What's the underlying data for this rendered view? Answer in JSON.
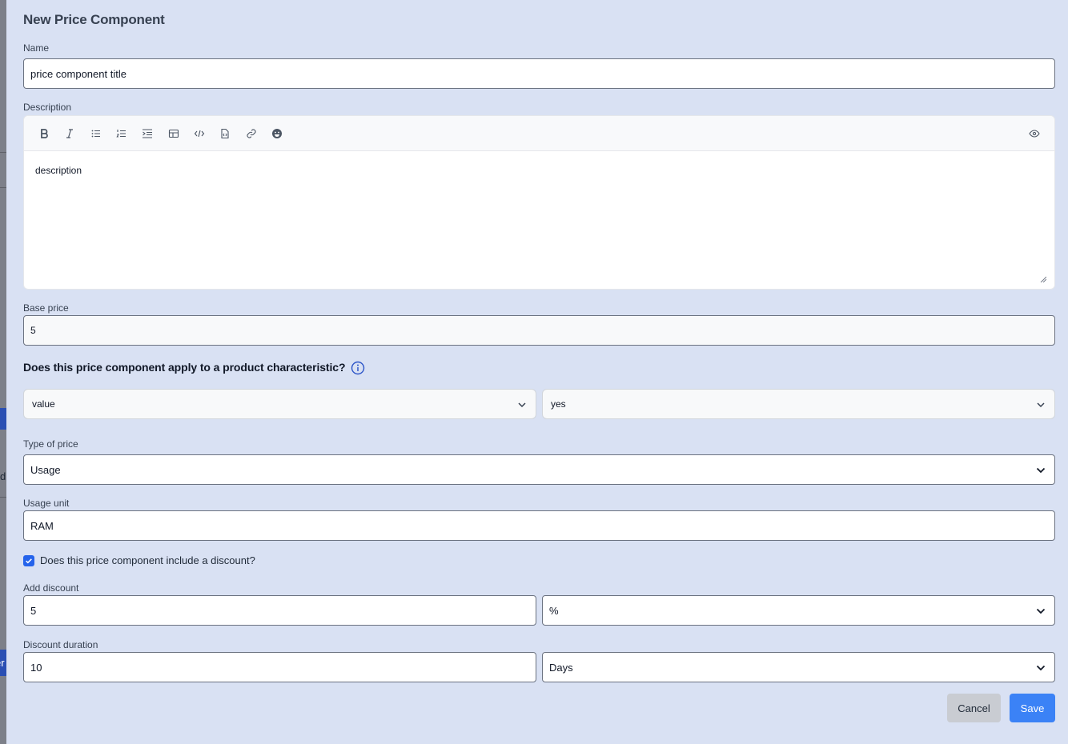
{
  "modal": {
    "title": "New Price Component"
  },
  "name": {
    "label": "Name",
    "value": "price component title"
  },
  "description": {
    "label": "Description",
    "value": "description",
    "toolbar": [
      "bold-icon",
      "italic-icon",
      "bullet-list-icon",
      "numbered-list-icon",
      "indent-icon",
      "table-icon",
      "code-icon",
      "file-code-icon",
      "link-icon",
      "emoji-icon",
      "preview-eye-icon"
    ]
  },
  "base_price": {
    "label": "Base price",
    "value": "5"
  },
  "characteristic": {
    "question": "Does this price component apply to a product characteristic?",
    "attribute_value": "value",
    "condition_value": "yes"
  },
  "type_of_price": {
    "label": "Type of price",
    "value": "Usage"
  },
  "usage_unit": {
    "label": "Usage unit",
    "value": "RAM"
  },
  "discount": {
    "checkbox_label": "Does this price component include a discount?",
    "checked": true,
    "add_label": "Add discount",
    "amount": "5",
    "unit": "%",
    "duration_label": "Discount duration",
    "duration": "10",
    "duration_unit": "Days"
  },
  "actions": {
    "cancel": "Cancel",
    "save": "Save"
  },
  "backdrop": {
    "fragment_1": "d",
    "fragment_2": "er"
  },
  "colors": {
    "modal_bg": "#d9e1f3",
    "primary": "#3b82f6",
    "checkbox": "#2563eb",
    "info_icon": "#2d55c8"
  }
}
